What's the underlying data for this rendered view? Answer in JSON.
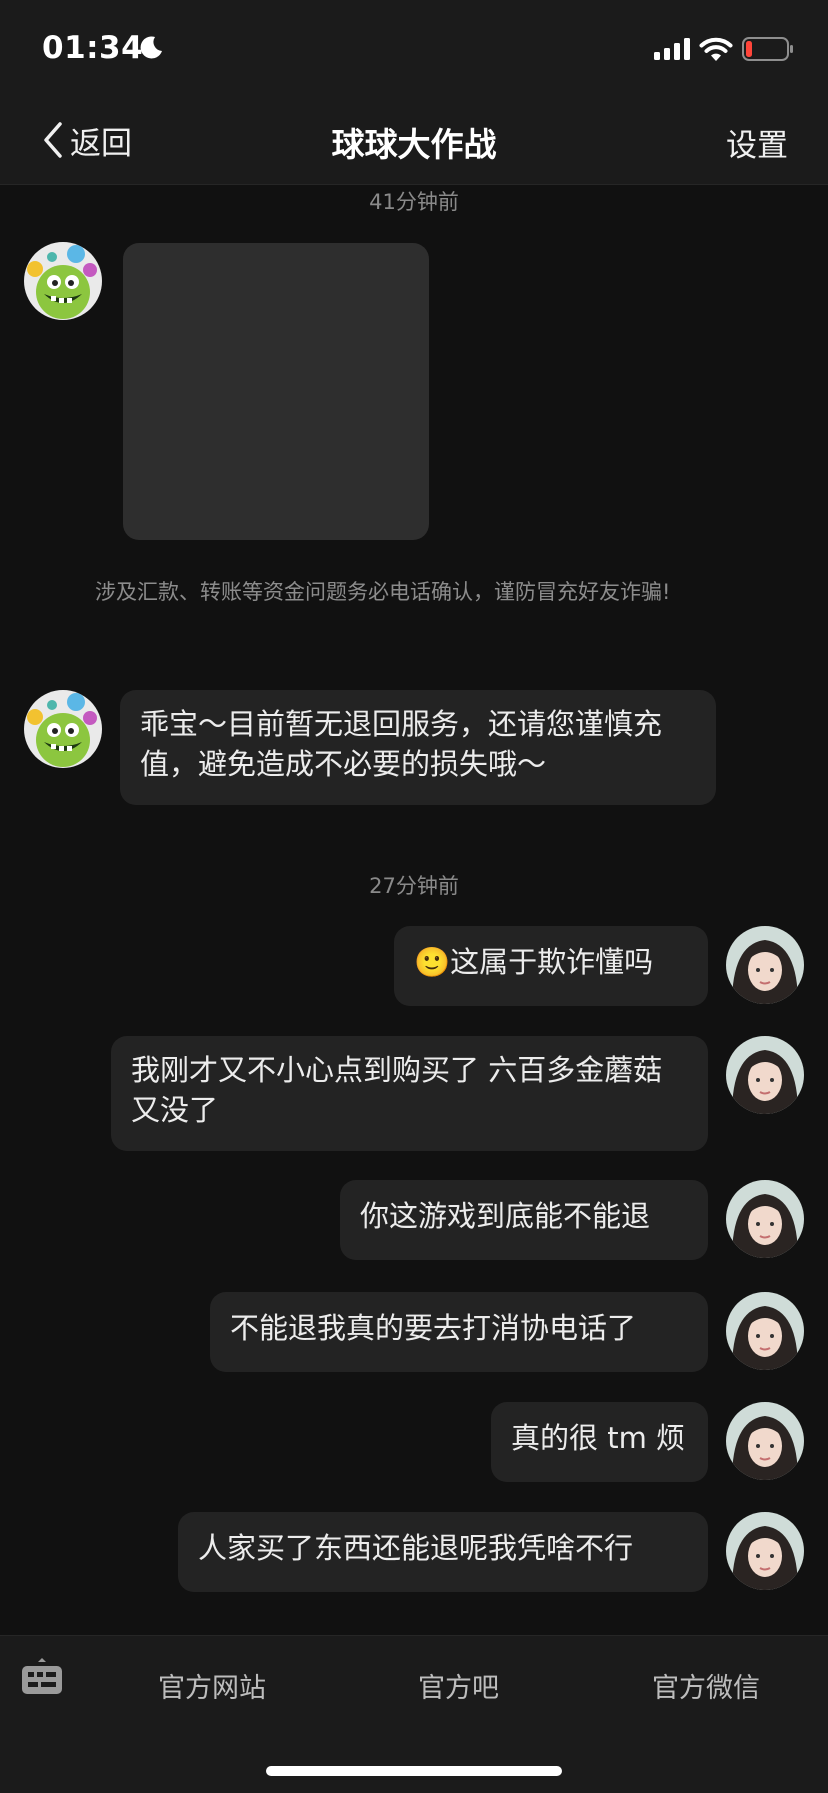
{
  "status_bar": {
    "time": "01:34",
    "icons": [
      "moon-icon",
      "signal-icon",
      "wifi-icon",
      "battery-low-icon"
    ],
    "battery_color": "#ff453a"
  },
  "header": {
    "back_label": "返回",
    "title": "球球大作战",
    "settings_label": "设置"
  },
  "chat": {
    "timestamp_1": "41分钟前",
    "warning": "涉及汇款、转账等资金问题务必电话确认，谨防冒充好友诈骗!",
    "official_reply": "乖宝～目前暂无退回服务，还请您谨慎充值，避免造成不必要的损失哦～",
    "timestamp_2": "27分钟前",
    "user_messages": [
      {
        "emoji": "🙂",
        "text": "这属于欺诈懂吗"
      },
      {
        "text": "我刚才又不小心点到购买了 六百多金蘑菇又没了"
      },
      {
        "text": "你这游戏到底能不能退"
      },
      {
        "text": "不能退我真的要去打消协电话了"
      },
      {
        "text": "真的很 tm 烦"
      },
      {
        "text": "人家买了东西还能退呢我凭啥不行"
      }
    ]
  },
  "bottom_menu": {
    "items": [
      "官方网站",
      "官方吧",
      "官方微信"
    ],
    "keyboard_icon": "keyboard-icon"
  }
}
